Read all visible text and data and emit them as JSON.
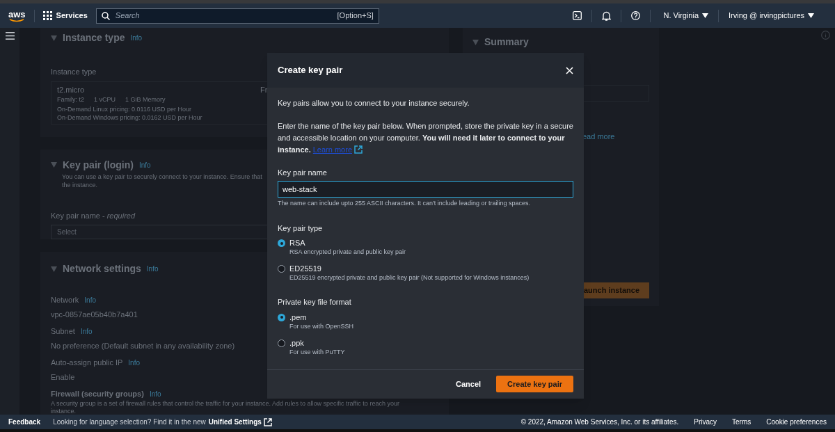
{
  "top_nav": {
    "logo": "aws",
    "services": "Services",
    "search": {
      "placeholder": "Search",
      "shortcut": "[Option+S]"
    },
    "region": "N. Virginia",
    "account": "Irving @ irvingpictures"
  },
  "background": {
    "instance_type": {
      "title": "Instance type",
      "info": "Info",
      "field_label": "Instance type",
      "option": {
        "name": "t2.micro",
        "specs": [
          "Family: t2",
          "1 vCPU",
          "1 GiB Memory"
        ],
        "pricing": [
          "On-Demand Linux pricing: 0.0116 USD per Hour",
          "On-Demand Windows pricing: 0.0162 USD per Hour"
        ],
        "cut_text": "Fr"
      }
    },
    "key_pair": {
      "title": "Key pair (login)",
      "info": "Info",
      "description": [
        "You can use a key pair to securely connect to your instance. Ensure that",
        "the instance."
      ],
      "field_label": "Key pair name - *required*",
      "placeholder": "Select"
    },
    "network": {
      "title": "Network settings",
      "info": "Info",
      "fields": [
        {
          "label": "Network",
          "info": "Info",
          "value": "vpc-0857ae05b40b7a401"
        },
        {
          "label": "Subnet",
          "info": "Info",
          "value": "No preference (Default subnet in any availability zone)"
        },
        {
          "label": "Auto-assign public IP",
          "info": "Info",
          "value": "Enable"
        }
      ],
      "firewall": {
        "label": "Firewall (security groups)",
        "info": "Info",
        "description": [
          "A security group is a set of firewall rules that control the traffic for your instance. Add rules to allow specific traffic to reach your",
          "instance."
        ]
      }
    },
    "summary": {
      "title": "Summary",
      "link": "ead more",
      "launch_button": "aunch instance"
    }
  },
  "dialog": {
    "title": "Create key pair",
    "intro": "Key pairs allow you to connect to your instance securely.",
    "body": "Enter the name of the key pair below. When prompted, store the private key in a secure and accessible location on your computer. **You will need it later to connect to your instance.**",
    "link": "Learn more",
    "name_field": {
      "label": "Key pair name",
      "value": "web-stack",
      "focused": true,
      "hint": "The name can include upto 255 ASCII characters. It can't include leading or trailing spaces."
    },
    "groups": [
      {
        "label": "Key pair type",
        "options": [
          {
            "label": "RSA",
            "description": "RSA encrypted private and public key pair",
            "selected": true
          },
          {
            "label": "ED25519",
            "description": "ED25519 encrypted private and public key pair (Not supported for Windows instances)",
            "selected": false
          }
        ]
      },
      {
        "label": "Private key file format",
        "options": [
          {
            "label": ".pem",
            "description": "For use with OpenSSH",
            "selected": true
          },
          {
            "label": ".ppk",
            "description": "For use with PuTTY",
            "selected": false
          }
        ]
      }
    ],
    "buttons": [
      {
        "label": "Cancel",
        "kind": "link"
      },
      {
        "label": "Create key pair",
        "kind": "primary"
      }
    ]
  },
  "footer": {
    "feedback": "Feedback",
    "notice": "Looking for language selection? Find it in the new",
    "settings_link": "Unified Settings",
    "copyright": "© 2022, Amazon Web Services, Inc. or its affiliates.",
    "links": [
      "Privacy",
      "Terms",
      "Cookie preferences"
    ]
  }
}
